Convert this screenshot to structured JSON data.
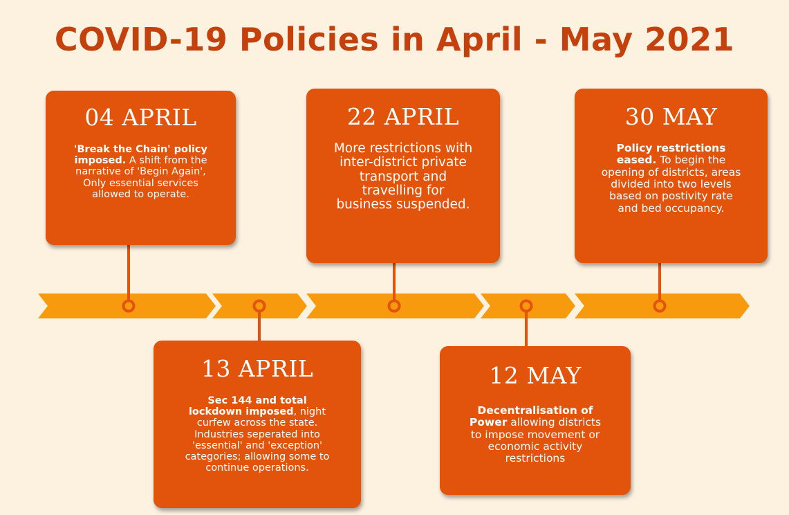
{
  "title": "COVID-19 Policies in April - May 2021",
  "colors": {
    "background": "#fdf1e0",
    "title": "#c4400c",
    "card": "#e2540b",
    "arrow": "#f79a0e",
    "connector": "#e2540b"
  },
  "events": [
    {
      "date": "04 APRIL",
      "lead": "'Break the Chain' policy imposed.",
      "rest": " A shift from the narrative of 'Begin Again', Only essential services allowed to operate."
    },
    {
      "date": "13 APRIL",
      "lead": "Sec 144 and total lockdown imposed",
      "rest": ", night curfew across the state. Industries seperated into 'essential' and 'exception' categories; allowing some to continue operations."
    },
    {
      "date": "22 APRIL",
      "lead": "",
      "rest": "More restrictions with inter-district private transport and travelling for business suspended."
    },
    {
      "date": "12 MAY",
      "lead": "Decentralisation of Power",
      "rest": " allowing districts to impose movement or economic activity restrictions"
    },
    {
      "date": "30 MAY",
      "lead": "Policy restrictions eased.",
      "rest": " To begin the opening of districts, areas divided into two levels based on postivity rate and bed occupancy."
    }
  ]
}
